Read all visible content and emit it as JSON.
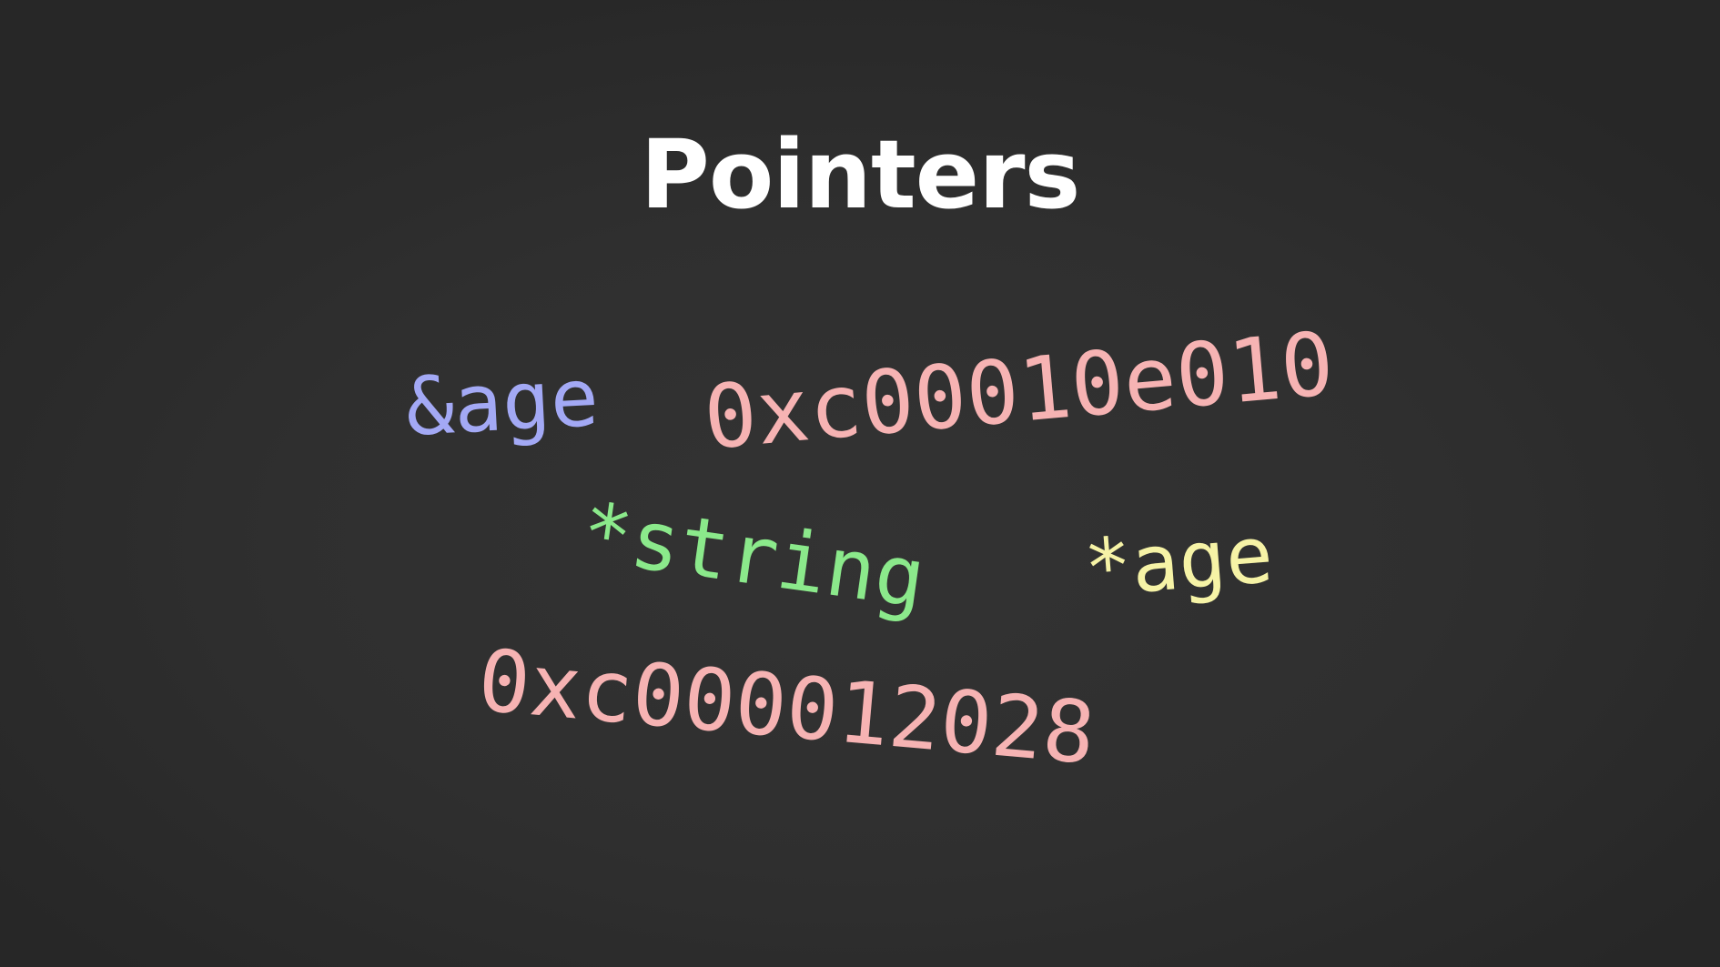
{
  "slide": {
    "title": "Pointers",
    "background_color": "#2f2f2f",
    "title_color": "#ffffff"
  },
  "words": [
    {
      "id": "ampersand-age",
      "text": "&age",
      "color": "#a3a9f5"
    },
    {
      "id": "address-1",
      "text": "0xc00010e010",
      "color": "#f6b3b3"
    },
    {
      "id": "star-string",
      "text": "*string",
      "color": "#8be98b"
    },
    {
      "id": "star-age",
      "text": "*age",
      "color": "#f6f3a6"
    },
    {
      "id": "address-2",
      "text": "0xc000012028",
      "color": "#f6b3b3"
    }
  ]
}
